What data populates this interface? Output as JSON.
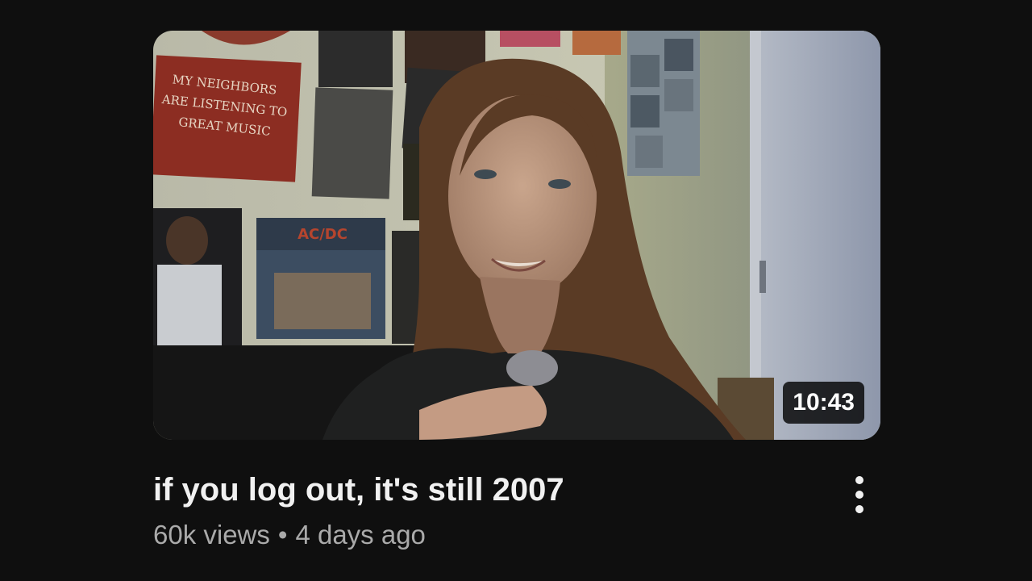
{
  "video": {
    "title": "if you log out, it's still 2007",
    "views": "60k views",
    "separator": "•",
    "age": "4 days ago",
    "duration": "10:43",
    "menu_icon": "more-vertical-icon"
  },
  "thumbnail": {
    "poster_text": [
      "MY NEIGHBORS",
      "ARE LISTENING TO",
      "GREAT MUSIC"
    ],
    "album_text": "AC/DC"
  },
  "colors": {
    "background": "#0f0f0f",
    "title": "#f1f1f1",
    "subtext": "#aaaaaa",
    "badge_bg": "#000000"
  }
}
